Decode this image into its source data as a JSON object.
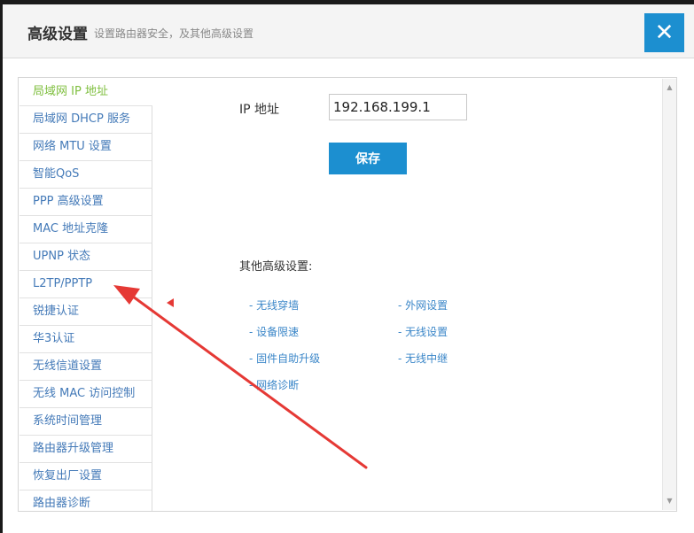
{
  "header": {
    "title": "高级设置",
    "subtitle": "设置路由器安全，及其他高级设置",
    "close_label": "✕"
  },
  "sidebar": {
    "items": [
      {
        "label": "局域网 IP 地址",
        "active": true
      },
      {
        "label": "局域网 DHCP 服务",
        "active": false
      },
      {
        "label": "网络 MTU 设置",
        "active": false
      },
      {
        "label": "智能QoS",
        "active": false
      },
      {
        "label": "PPP 高级设置",
        "active": false
      },
      {
        "label": "MAC 地址克隆",
        "active": false
      },
      {
        "label": "UPNP 状态",
        "active": false
      },
      {
        "label": "L2TP/PPTP",
        "active": false
      },
      {
        "label": "锐捷认证",
        "active": false
      },
      {
        "label": "华3认证",
        "active": false
      },
      {
        "label": "无线信道设置",
        "active": false
      },
      {
        "label": "无线 MAC 访问控制",
        "active": false
      },
      {
        "label": "系统时间管理",
        "active": false
      },
      {
        "label": "路由器升级管理",
        "active": false
      },
      {
        "label": "恢复出厂设置",
        "active": false
      },
      {
        "label": "路由器诊断",
        "active": false
      }
    ]
  },
  "main": {
    "ip_label": "IP 地址",
    "ip_value": "192.168.199.1",
    "save_label": "保存",
    "other_title": "其他高级设置:",
    "links": {
      "firewall": "- 无线穿墙",
      "wan": "- 外网设置",
      "speed_limit": "- 设备限速",
      "wireless": "- 无线设置",
      "auto_upgrade": "- 固件自助升级",
      "relay": "- 无线中继",
      "diagnose": "- 网络诊断"
    }
  },
  "colors": {
    "accent": "#1c8fd0",
    "active_item": "#7fbf3f",
    "link": "#3a86c8",
    "annotation": "#e53935"
  }
}
